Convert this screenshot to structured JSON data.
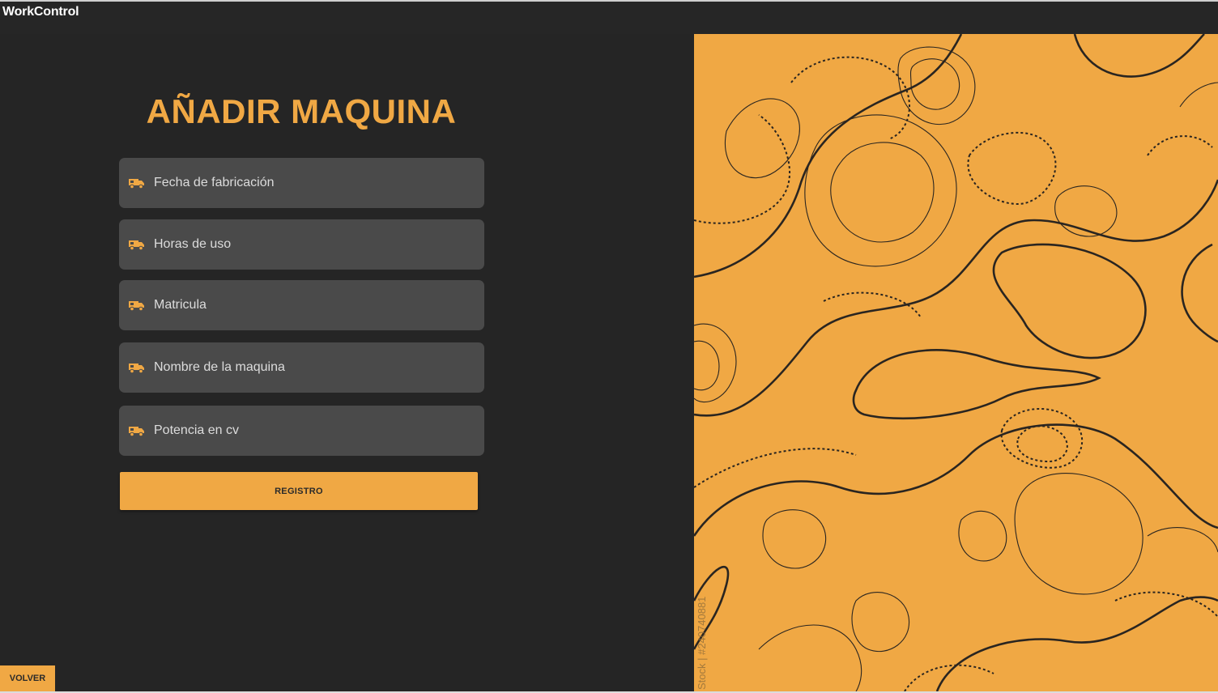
{
  "app": {
    "title": "WorkControl"
  },
  "form": {
    "title": "AÑADIR MAQUINA",
    "fields": [
      {
        "placeholder": "Fecha de fabricación",
        "value": "",
        "icon": "truck-icon"
      },
      {
        "placeholder": "Horas de uso",
        "value": "",
        "icon": "truck-icon"
      },
      {
        "placeholder": "Matricula",
        "value": "",
        "icon": "truck-icon"
      },
      {
        "placeholder": "Nombre de la maquina",
        "value": "",
        "icon": "truck-icon"
      },
      {
        "placeholder": "Potencia en cv",
        "value": "",
        "icon": "truck-icon"
      }
    ],
    "submit_label": "REGISTRO"
  },
  "footer": {
    "back_label": "VOLVER"
  },
  "image": {
    "watermark": "Stock | #240740881"
  },
  "colors": {
    "accent": "#f0a844",
    "background": "#252525",
    "field": "#4a4a4a",
    "contour": "#2a2520"
  }
}
